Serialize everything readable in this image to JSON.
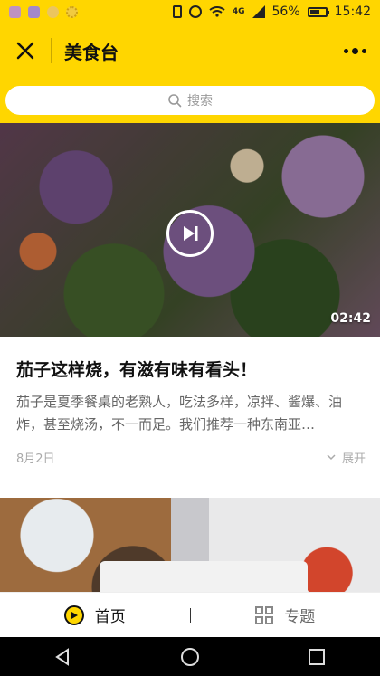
{
  "status_bar": {
    "network": "4G",
    "battery_percent": "56%",
    "battery_level": 0.56,
    "time": "15:42",
    "icons": [
      "app-icon-1",
      "app-icon-2",
      "app-icon-3",
      "app-icon-4",
      "vibrate-icon",
      "alarm-icon",
      "wifi-icon",
      "signal-icon",
      "battery-icon"
    ]
  },
  "header": {
    "title": "美食台",
    "close_icon": "close-icon",
    "more_icon": "more-icon"
  },
  "search": {
    "placeholder": "搜索",
    "icon": "search-icon"
  },
  "feed": {
    "items": [
      {
        "duration": "02:42",
        "title": "茄子这样烧，有滋有味有看头！",
        "description": "茄子是夏季餐桌的老熟人，吃法多样，凉拌、酱爆、油炸，甚至烧汤，不一而足。我们推荐一种东南亚…",
        "date": "8月2日",
        "expand_label": "展开"
      }
    ]
  },
  "bottom_nav": {
    "tabs": [
      {
        "label": "首页",
        "icon": "home-icon",
        "active": true
      },
      {
        "label": "专题",
        "icon": "topics-icon",
        "active": false
      }
    ],
    "accent": "#ffd600"
  },
  "android_nav": [
    "back-icon",
    "home-circle-icon",
    "recents-icon"
  ]
}
